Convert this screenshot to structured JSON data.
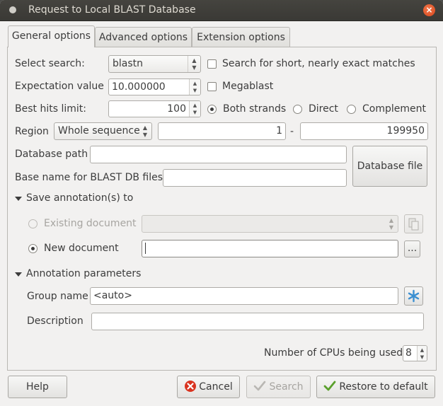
{
  "window": {
    "title": "Request to Local BLAST Database",
    "close_glyph": "×"
  },
  "tabs": [
    {
      "label": "General options",
      "active": true
    },
    {
      "label": "Advanced options",
      "active": false
    },
    {
      "label": "Extension options",
      "active": false
    }
  ],
  "search": {
    "label": "Select search:",
    "value": "blastn",
    "short_matches_label": "Search for short, nearly exact matches",
    "short_matches_checked": false
  },
  "expectation": {
    "label": "Expectation value",
    "value": "10.000000",
    "megablast_label": "Megablast",
    "megablast_checked": false
  },
  "hits": {
    "label": "Best hits limit:",
    "value": "100",
    "strands": [
      {
        "label": "Both strands",
        "selected": true
      },
      {
        "label": "Direct",
        "selected": false
      },
      {
        "label": "Complement",
        "selected": false
      }
    ]
  },
  "region": {
    "label": "Region",
    "mode": "Whole sequence",
    "start": "1",
    "separator": "-",
    "end": "199950"
  },
  "database": {
    "path_label": "Database path",
    "path_value": "",
    "basename_label": "Base name for BLAST DB files",
    "basename_value": "",
    "file_button": "Database file"
  },
  "save_annotation": {
    "header": "Save annotation(s) to",
    "existing_label": "Existing document",
    "existing_value": "",
    "new_label": "New document",
    "new_value": "",
    "browse_label": "..."
  },
  "annotation_params": {
    "header": "Annotation parameters",
    "group_label": "Group name",
    "group_value": "<auto>",
    "description_label": "Description",
    "description_value": ""
  },
  "cpus": {
    "label": "Number of CPUs being used",
    "value": "8"
  },
  "buttons": {
    "help": "Help",
    "cancel": "Cancel",
    "search": "Search",
    "restore": "Restore to default"
  },
  "colors": {
    "cancel_icon": "#d9331f",
    "restore_icon": "#5aa02c",
    "asterisk_icon": "#3b8fd1"
  }
}
